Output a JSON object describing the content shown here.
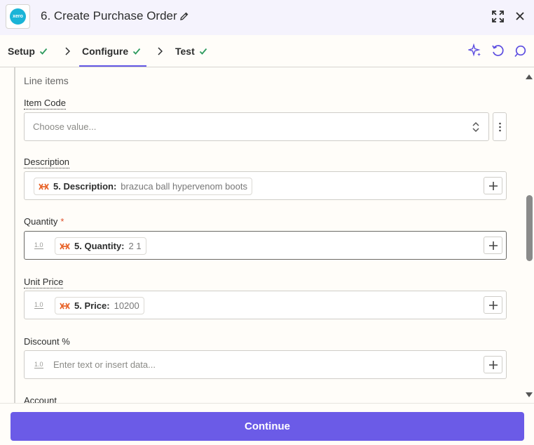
{
  "header": {
    "logo_text": "xero",
    "title": "6. Create Purchase Order"
  },
  "tabs": [
    {
      "label": "Setup"
    },
    {
      "label": "Configure"
    },
    {
      "label": "Test"
    }
  ],
  "form": {
    "section_label": "Line items",
    "item_code": {
      "label": "Item Code",
      "placeholder": "Choose value..."
    },
    "description": {
      "label": "Description",
      "pill_key": "5. Description:",
      "pill_value": "brazuca ball hypervenom boots"
    },
    "quantity": {
      "label": "Quantity",
      "required_mark": "*",
      "type_badge": "1.0",
      "pill_key": "5. Quantity:",
      "pill_value": "2  1"
    },
    "unit_price": {
      "label": "Unit Price",
      "type_badge": "1.0",
      "pill_key": "5. Price:",
      "pill_value": "10200"
    },
    "discount": {
      "label": "Discount %",
      "type_badge": "1.0",
      "placeholder": "Enter text or insert data..."
    },
    "account": {
      "label": "Account"
    }
  },
  "footer": {
    "continue_label": "Continue"
  },
  "colors": {
    "accent": "#6b5be7",
    "check": "#2e9b5f",
    "zap": "#e8652c"
  }
}
